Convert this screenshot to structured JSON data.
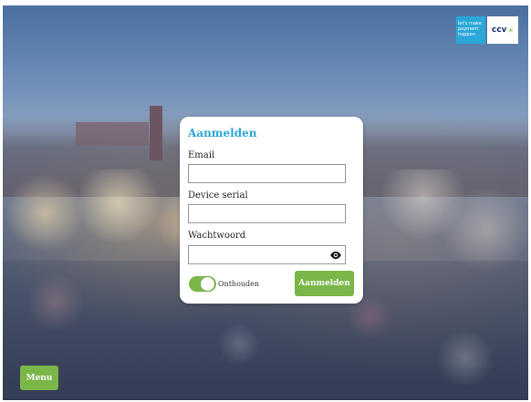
{
  "brand": {
    "tagline": "let's make payment happen",
    "logo_text": "ccv"
  },
  "login": {
    "title": "Aanmelden",
    "email_label": "Email",
    "email_value": "",
    "device_serial_label": "Device serial",
    "device_serial_value": "",
    "password_label": "Wachtwoord",
    "password_value": "",
    "remember_label": "Onthouden",
    "remember_on": true,
    "submit_label": "Aanmelden"
  },
  "menu": {
    "label": "Menu"
  },
  "colors": {
    "accent_blue": "#2aa7d9",
    "accent_green": "#7ab648"
  },
  "icons": {
    "password_toggle": "eye-icon"
  }
}
